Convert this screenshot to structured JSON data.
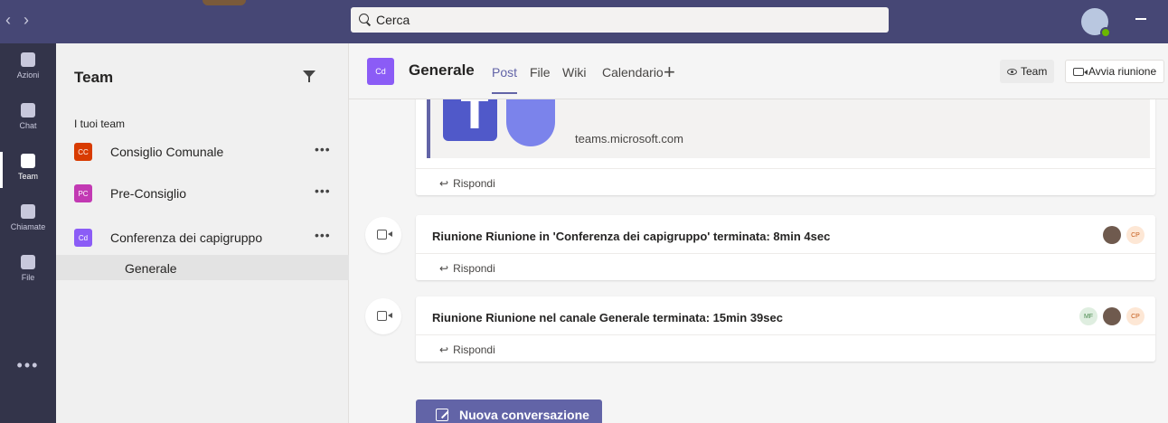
{
  "app": {
    "accent": "#6264a7",
    "topbar_color": "#464775",
    "rail_color": "#33344a"
  },
  "topbar": {
    "nav_back": "‹",
    "nav_forward": "›",
    "search_placeholder": "Cerca"
  },
  "rail": {
    "items": [
      {
        "label": "Azioni",
        "icon": "bell-icon"
      },
      {
        "label": "Chat",
        "icon": "chat-icon"
      },
      {
        "label": "Team",
        "icon": "teams-icon",
        "active": true
      },
      {
        "label": "Chiamate",
        "icon": "phone-icon"
      },
      {
        "label": "File",
        "icon": "file-icon"
      }
    ],
    "more": "•••"
  },
  "panel": {
    "title": "Team",
    "section_label": "I tuoi team",
    "teams": [
      {
        "initials": "CC",
        "name": "Consiglio Comunale",
        "color": "#d83b01"
      },
      {
        "initials": "PC",
        "name": "Pre-Consiglio",
        "color": "#c239b3"
      },
      {
        "initials": "Cd",
        "name": "Conferenza dei capigruppo",
        "color": "#8b5cf6"
      }
    ],
    "more": "•••",
    "selected_channel": "Generale"
  },
  "channel": {
    "initials": "Cd",
    "title": "Generale",
    "tabs": [
      "Post",
      "File",
      "Wiki",
      "Calendario"
    ],
    "add_tab": "+",
    "team_button": "Team",
    "meet_button": "Avvia riunione"
  },
  "feed": {
    "preview_url": "teams.microsoft.com",
    "reply_label": "Rispondi",
    "meetings": [
      {
        "title": "Riunione Riunione in 'Conferenza dei capigruppo' terminata: 8min 4sec",
        "avatars": [
          "photo",
          "CP"
        ]
      },
      {
        "title": "Riunione Riunione nel canale Generale terminata: 15min 39sec",
        "avatars": [
          "MF",
          "photo",
          "CP"
        ]
      }
    ],
    "new_conversation": "Nuova conversazione"
  }
}
